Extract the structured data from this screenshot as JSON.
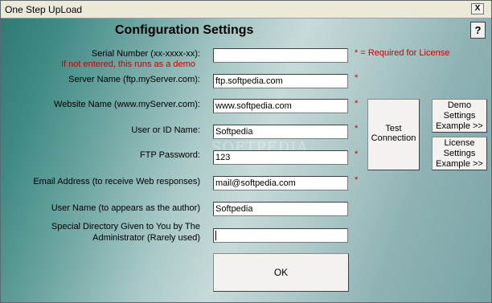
{
  "window": {
    "title": "One Step UpLoad",
    "close_label": "X"
  },
  "heading": "Configuration Settings",
  "help_label": "?",
  "required_note": "* = Required for License",
  "asterisk": "*",
  "warning": "If not entered, this runs as a demo",
  "fields": [
    {
      "label": "Serial Number (xx-xxxx-xx):",
      "value": ""
    },
    {
      "label": "Server Name (ftp.myServer.com):",
      "value": "ftp.softpedia.com"
    },
    {
      "label": "Website Name (www.myServer.com):",
      "value": "www.softpedia.com"
    },
    {
      "label": "User or ID Name:",
      "value": "Softpedia"
    },
    {
      "label": "FTP Password:",
      "value": "123"
    },
    {
      "label": "Email Address (to receive Web responses)",
      "value": "mail@softpedia.com"
    },
    {
      "label": "User Name (to appears as the author)",
      "value": "Softpedia"
    },
    {
      "label_line1": "Special Directory Given to You by The",
      "label_line2": "Administrator (Rarely used)",
      "value": ""
    }
  ],
  "buttons": {
    "test_line1": "Test",
    "test_line2": "Connection",
    "demo_line1": "Demo",
    "demo_line2": "Settings",
    "demo_line3": "Example >>",
    "license_line1": "License",
    "license_line2": "Settings",
    "license_line3": "Example >>",
    "ok": "OK"
  },
  "watermark": "SOFTPEDIA"
}
